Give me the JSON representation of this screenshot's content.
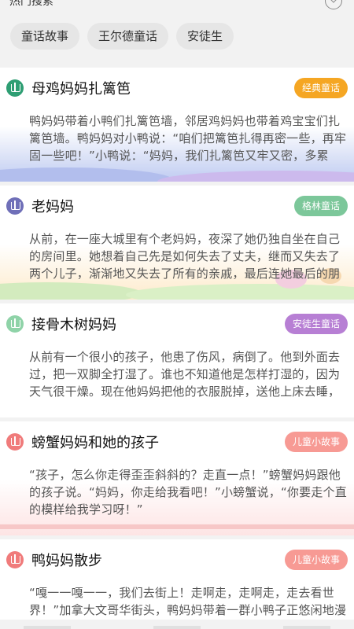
{
  "header": {
    "hot_title": "热门搜索",
    "tags": [
      "童话故事",
      "王尔德童话",
      "安徒生"
    ]
  },
  "stories": [
    {
      "title": "母鸡妈妈扎篱笆",
      "badge": "经典童话",
      "badge_color": "#f5a623",
      "icon_color": "#2e9e73",
      "excerpt": "鸭妈妈带着小鸭们扎篱笆墙，邻居鸡妈妈也带着鸡宝宝们扎篱笆墙。鸭妈妈对小鸭说：“咱们把篱笆扎得再密一些，再牢固一些吧！”小鸭说：“妈妈，我们扎篱笆又牢又密，多累啊！...",
      "art": "blue"
    },
    {
      "title": "老妈妈",
      "badge": "格林童话",
      "badge_color": "#7cc79a",
      "icon_color": "#6f6fb8",
      "excerpt": "从前，在一座大城里有个老妈妈，夜深了她仍独自坐在自己的房间里。她想着自己先是如何失去了丈夫，继而又失去了两个儿子，渐渐地又失去了所有的亲戚，最后连她最后的朋友也...",
      "art": "green"
    },
    {
      "title": "接骨木树妈妈",
      "badge": "安徒生童话",
      "badge_color": "#b77fd4",
      "icon_color": "#8fd3a8",
      "excerpt": "从前有一个很小的孩子，他患了伤风，病倒了。他到外面去过，把一双脚全打湿了。谁也不知道他是怎样打湿的，因为天气很干燥。现在他妈妈把他的衣服脱掉，送他上床去睡，同...",
      "art": "none"
    },
    {
      "title": "螃蟹妈妈和她的孩子",
      "badge": "儿童小故事",
      "badge_color": "#f79a94",
      "icon_color": "#f07b7b",
      "excerpt": "“孩子，怎么你走得歪歪斜斜的？走直一点！”螃蟹妈妈跟他的孩子说。“妈妈，你走给我看吧！”小螃蟹说，“你要走个直的模样给我学习呀！”",
      "art": "pink"
    },
    {
      "title": "鸭妈妈散步",
      "badge": "儿童小故事",
      "badge_color": "#f79a94",
      "icon_color": "#f07b7b",
      "excerpt": "“嘎一一嘎一一，我们去街上！走啊走，走啊走，走去看世界！”加拿大文哥华街头，鸭妈妈带着一群小鸭子正悠闲地漫步呢。岗亭上，巡警目送它们远去，露出了会心的微笑……这件事...",
      "art": "none"
    }
  ]
}
